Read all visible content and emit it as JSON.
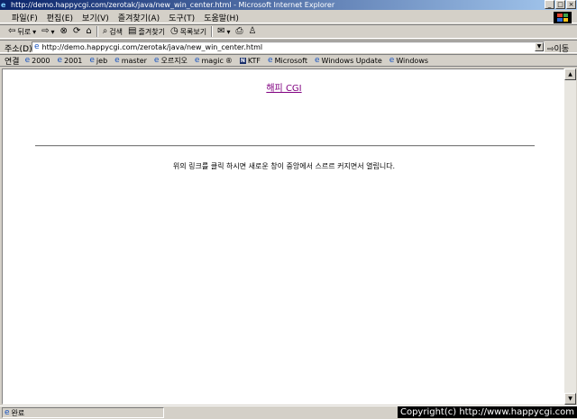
{
  "window": {
    "title": "http://demo.happycgi.com/zerotak/java/new_win_center.html - Microsoft Internet Explorer"
  },
  "menu": [
    "파일(F)",
    "편집(E)",
    "보기(V)",
    "즐겨찾기(A)",
    "도구(T)",
    "도움말(H)"
  ],
  "toolbar": {
    "back": "뒤로",
    "search": "검색",
    "favorites": "즐겨찾기",
    "history": "목록보기"
  },
  "address": {
    "label": "주소(D)",
    "url": "http://demo.happycgi.com/zerotak/java/new_win_center.html",
    "go": "이동"
  },
  "links": {
    "label": "연결",
    "items": [
      "2000",
      "2001",
      "jeb",
      "master",
      "오르지오",
      "magic",
      "KTF",
      "Microsoft",
      "Windows Update",
      "Windows"
    ]
  },
  "content": {
    "link_text": "해피 CGI",
    "message": "위의 링크를 클릭 하시면 새로운 창이 중앙에서 스르르 커지면서 열립니다."
  },
  "status": {
    "text": "완료",
    "copyright": "Copyright(c) http://www.happycgi.com"
  }
}
